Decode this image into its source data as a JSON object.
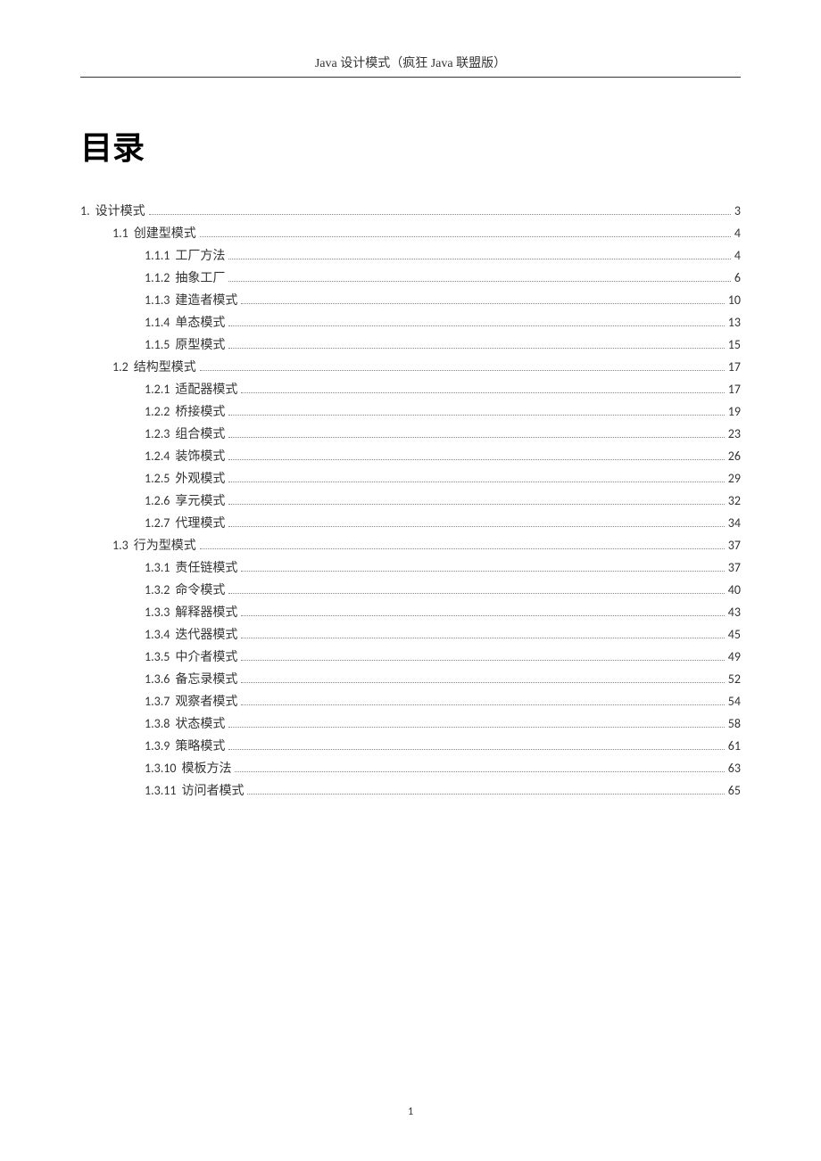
{
  "header": "Java 设计模式（疯狂 Java 联盟版）",
  "heading": "目录",
  "page_number": "1",
  "toc": [
    {
      "level": 1,
      "num": "1.",
      "label": "设计模式",
      "page": "3"
    },
    {
      "level": 2,
      "num": "1.1",
      "label": "创建型模式",
      "page": "4"
    },
    {
      "level": 3,
      "num": "1.1.1",
      "label": "工厂方法",
      "page": "4"
    },
    {
      "level": 3,
      "num": "1.1.2",
      "label": "抽象工厂",
      "page": "6"
    },
    {
      "level": 3,
      "num": "1.1.3",
      "label": "建造者模式",
      "page": "10"
    },
    {
      "level": 3,
      "num": "1.1.4",
      "label": "单态模式",
      "page": "13"
    },
    {
      "level": 3,
      "num": "1.1.5",
      "label": "原型模式",
      "page": "15"
    },
    {
      "level": 2,
      "num": "1.2",
      "label": "结构型模式",
      "page": "17"
    },
    {
      "level": 3,
      "num": "1.2.1",
      "label": "适配器模式",
      "page": "17"
    },
    {
      "level": 3,
      "num": "1.2.2",
      "label": "桥接模式",
      "page": "19"
    },
    {
      "level": 3,
      "num": "1.2.3",
      "label": "组合模式",
      "page": "23"
    },
    {
      "level": 3,
      "num": "1.2.4",
      "label": "装饰模式",
      "page": "26"
    },
    {
      "level": 3,
      "num": "1.2.5",
      "label": "外观模式",
      "page": "29"
    },
    {
      "level": 3,
      "num": "1.2.6",
      "label": "享元模式",
      "page": "32"
    },
    {
      "level": 3,
      "num": "1.2.7",
      "label": "代理模式",
      "page": "34"
    },
    {
      "level": 2,
      "num": "1.3",
      "label": "行为型模式",
      "page": "37"
    },
    {
      "level": 3,
      "num": "1.3.1",
      "label": "责任链模式",
      "page": "37"
    },
    {
      "level": 3,
      "num": "1.3.2",
      "label": "命令模式",
      "page": "40"
    },
    {
      "level": 3,
      "num": "1.3.3",
      "label": "解释器模式",
      "page": "43"
    },
    {
      "level": 3,
      "num": "1.3.4",
      "label": "迭代器模式",
      "page": "45"
    },
    {
      "level": 3,
      "num": "1.3.5",
      "label": "中介者模式",
      "page": "49"
    },
    {
      "level": 3,
      "num": "1.3.6",
      "label": "备忘录模式",
      "page": "52"
    },
    {
      "level": 3,
      "num": "1.3.7",
      "label": "观察者模式",
      "page": "54"
    },
    {
      "level": 3,
      "num": "1.3.8",
      "label": "状态模式",
      "page": "58"
    },
    {
      "level": 3,
      "num": "1.3.9",
      "label": "策略模式",
      "page": "61"
    },
    {
      "level": 3,
      "num": "1.3.10",
      "label": "模板方法",
      "page": "63"
    },
    {
      "level": 3,
      "num": "1.3.11",
      "label": "访问者模式",
      "page": "65"
    }
  ]
}
